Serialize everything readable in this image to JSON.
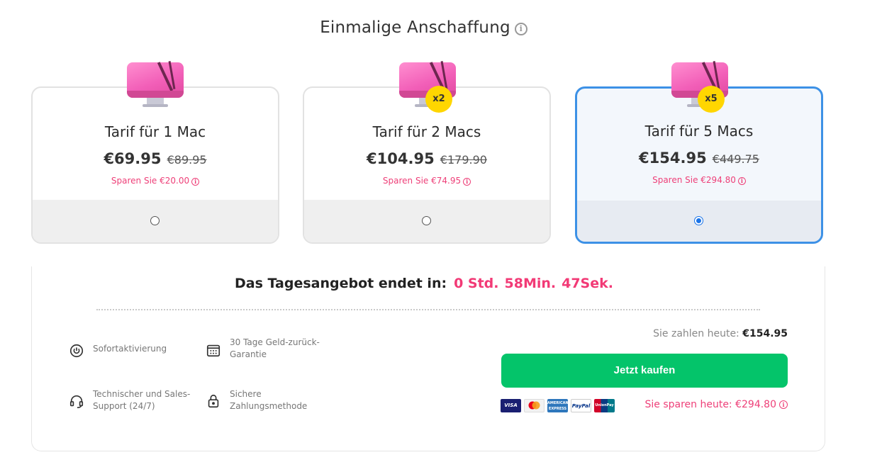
{
  "header": {
    "title": "Einmalige Anschaffung",
    "info_icon": "info-icon"
  },
  "plans": [
    {
      "name": "Tarif für 1 Mac",
      "price": "€69.95",
      "old_price": "€89.95",
      "save": "Sparen Sie €20.00",
      "badge": "",
      "selected": false
    },
    {
      "name": "Tarif für 2 Macs",
      "price": "€104.95",
      "old_price": "€179.90",
      "save": "Sparen Sie €74.95",
      "badge": "x2",
      "selected": false
    },
    {
      "name": "Tarif für 5 Macs",
      "price": "€154.95",
      "old_price": "€449.75",
      "save": "Sparen Sie €294.80",
      "badge": "x5",
      "selected": true
    }
  ],
  "offer": {
    "label": "Das Tagesangebot endet in:",
    "hours": "0 Std.",
    "minutes": "58Min.",
    "seconds": "47Sek."
  },
  "features": [
    {
      "text": "Sofortaktivierung",
      "icon": "power-icon"
    },
    {
      "text": "30 Tage Geld-zurück-Garantie",
      "icon": "calendar-icon"
    },
    {
      "text": "Technischer und Sales-Support (24/7)",
      "icon": "headset-icon"
    },
    {
      "text": "Sichere Zahlungsmethode",
      "icon": "lock-icon"
    }
  ],
  "checkout": {
    "pay_today_label": "Sie zahlen heute:",
    "pay_today_value": "€154.95",
    "buy_label": "Jetzt kaufen",
    "saved_label": "Sie sparen heute: €294.80",
    "payment_methods": [
      "VISA",
      "Mastercard",
      "American Express",
      "PayPal",
      "UnionPay"
    ]
  },
  "colors": {
    "accent_green": "#04c46a",
    "accent_pink": "#ee3f78",
    "selected_border": "#3d91e6",
    "badge_yellow": "#ffd600"
  }
}
